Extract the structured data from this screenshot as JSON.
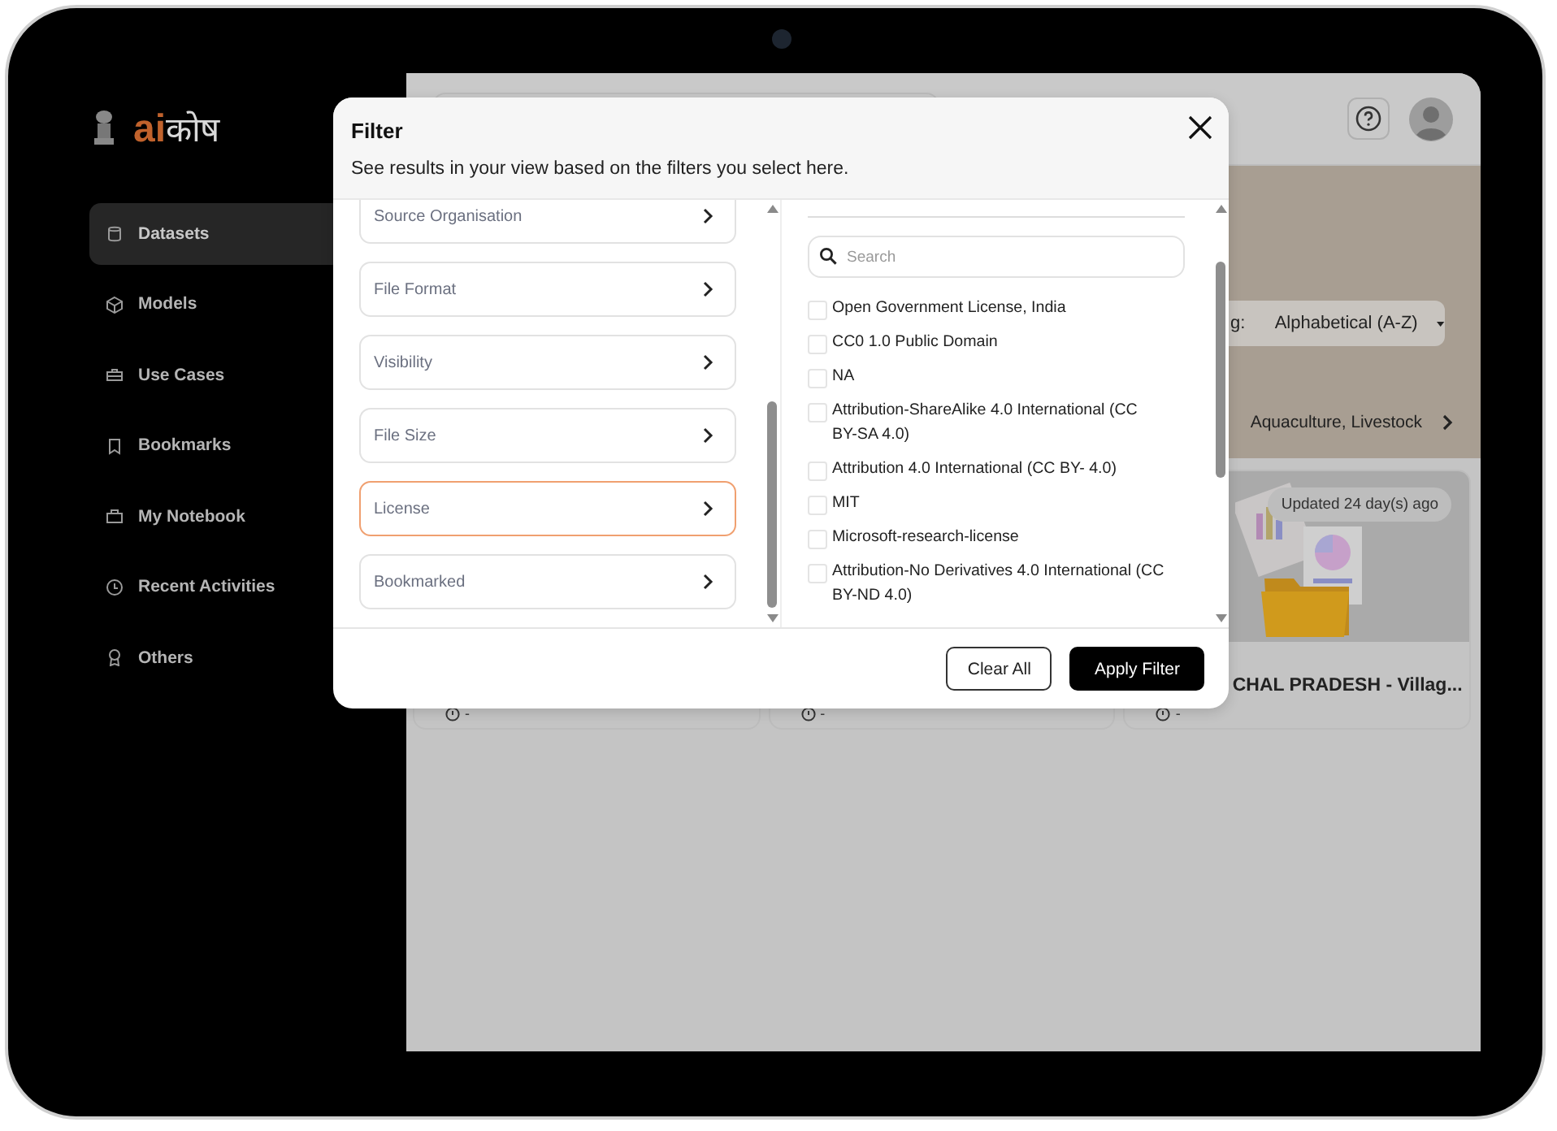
{
  "sidebar": {
    "logo": {
      "latin": "ai",
      "devanagari": "कोष"
    },
    "items": [
      {
        "label": "Datasets",
        "selected": true
      },
      {
        "label": "Models",
        "selected": false
      },
      {
        "label": "Use Cases",
        "selected": false
      },
      {
        "label": "Bookmarks",
        "selected": false
      },
      {
        "label": "My Notebook",
        "selected": false
      },
      {
        "label": "Recent Activities",
        "selected": false
      },
      {
        "label": "Others",
        "selected": false
      }
    ]
  },
  "toolbar": {
    "sort_prefix": "g:",
    "sort_value": "Alphabetical (A-Z)",
    "category_link": "Aquaculture, Livestock"
  },
  "cards": [
    {
      "stat": "-"
    },
    {
      "stat": "-"
    },
    {
      "kind": "picture",
      "badge": "Updated 24 day(s) ago",
      "title": "CHAL PRADESH - Villag...",
      "stat": "-"
    }
  ],
  "filter_dialog": {
    "title": "Filter",
    "subtitle": "See results in your view based on the filters you select here.",
    "categories": [
      {
        "label": "Source Organisation",
        "selected": false
      },
      {
        "label": "File Format",
        "selected": false
      },
      {
        "label": "Visibility",
        "selected": false
      },
      {
        "label": "File Size",
        "selected": false
      },
      {
        "label": "License",
        "selected": true
      },
      {
        "label": "Bookmarked",
        "selected": false
      }
    ],
    "search": {
      "placeholder": "Search"
    },
    "options": [
      {
        "label": "Open Government License, India",
        "checked": false
      },
      {
        "label": "CC0 1.0 Public Domain",
        "checked": false
      },
      {
        "label": "NA",
        "checked": false
      },
      {
        "label": "Attribution-ShareAlike 4.0 International (CC BY-SA 4.0)",
        "checked": false
      },
      {
        "label": "Attribution 4.0 International (CC BY- 4.0)",
        "checked": false
      },
      {
        "label": "MIT",
        "checked": false
      },
      {
        "label": "Microsoft-research-license",
        "checked": false
      },
      {
        "label": "Attribution-No Derivatives 4.0 International (CC BY-ND 4.0)",
        "checked": false
      }
    ],
    "buttons": [
      {
        "label": "Clear All",
        "kind": "secondary"
      },
      {
        "label": "Apply Filter",
        "kind": "primary"
      }
    ]
  }
}
